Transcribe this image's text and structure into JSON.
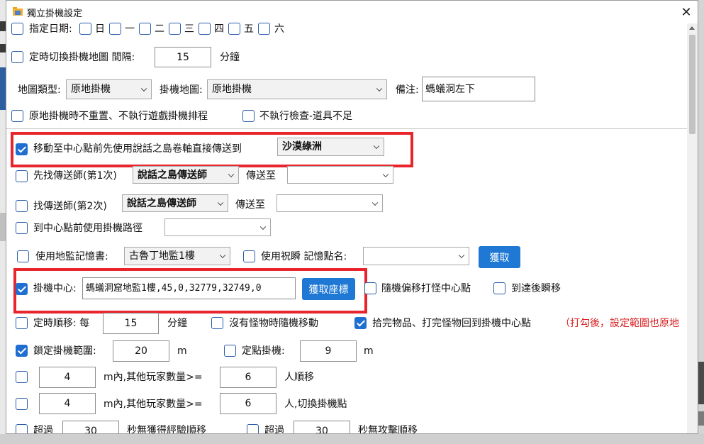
{
  "window": {
    "title": "獨立掛機設定",
    "close_glyph": "✕"
  },
  "rows": {
    "date": {
      "label": "指定日期:",
      "days": [
        "日",
        "一",
        "二",
        "三",
        "四",
        "五",
        "六"
      ]
    },
    "switch_map": {
      "label": "定時切換掛機地圖 間隔:",
      "value": "15",
      "unit": "分鐘"
    },
    "map_row": {
      "map_type_label": "地圖類型:",
      "map_type_value": "原地掛機",
      "hang_map_label": "掛機地圖:",
      "hang_map_value": "原地掛機",
      "note_label": "備注:",
      "note_value": "螞蟻洞左下"
    },
    "no_reset": {
      "label": "原地掛機時不重置、不執行遊戲掛機排程",
      "checked": false
    },
    "no_check": {
      "label": "不執行檢查-道具不足",
      "checked": false
    },
    "move_center": {
      "label": "移動至中心點前先使用說話之島卷軸直接傳送到",
      "value": "沙漠綠洲",
      "checked": true
    },
    "find_tp1": {
      "label": "先找傳送師(第1次)",
      "npc": "說話之島傳送師",
      "to_label": "傳送至",
      "checked": false
    },
    "find_tp2": {
      "label": "找傳送師(第2次)",
      "npc": "說話之島傳送師",
      "to_label": "傳送至",
      "checked": false
    },
    "center_path": {
      "label": "到中心點前使用掛機路徑",
      "checked": false
    },
    "memory_book": {
      "label": "使用地監記憶書:",
      "value": "古魯丁地監1樓",
      "checked": false,
      "blessing_label": "使用祝瞬 記憶點名:",
      "blessing_checked": false,
      "fetch_label": "獲取"
    },
    "hang_center": {
      "label": "掛機中心:",
      "value": "螞蟻洞窟地監1樓,45,0,32779,32749,0",
      "checked": true,
      "fetch_coord_label": "獲取座標",
      "random_offset_label": "隨機偏移打怪中心點",
      "random_offset_checked": false,
      "teleport_label": "到達後瞬移",
      "teleport_checked": false
    },
    "timed_move": {
      "label": "定時順移: 每",
      "value": "15",
      "unit": "分鐘",
      "checked": false,
      "no_monster_label": "沒有怪物時隨機移動",
      "no_monster_checked": false,
      "pickup_label": "拾完物品、打完怪物回到掛機中心點",
      "pickup_checked": true,
      "pickup_note": "（打勾後，設定範圍也原地"
    },
    "lock_range": {
      "label": "鎖定掛機範圍:",
      "value": "20",
      "unit": "m",
      "checked": true,
      "fixed_label": "定點掛機:",
      "fixed_value": "9",
      "fixed_unit": "m",
      "fixed_checked": false
    },
    "players1": {
      "range": "4",
      "mid": "m內,其他玩家數量>=",
      "count": "6",
      "suffix": "人順移",
      "checked": false
    },
    "players2": {
      "range": "4",
      "mid": "m內,其他玩家數量>=",
      "count": "6",
      "suffix": "人,切換掛機點",
      "checked": false
    },
    "exceed1": {
      "label": "超過",
      "value": "30",
      "suffix": "秒無獲得經驗順移"
    },
    "exceed2": {
      "label": "超過",
      "value": "30",
      "suffix": "秒無攻擊順移"
    }
  },
  "colors": {
    "accent": "#1e78d4",
    "highlight": "#e8252d",
    "note": "#d81e1e"
  },
  "icons": {
    "app": "folder-app-icon",
    "close": "close-icon"
  }
}
